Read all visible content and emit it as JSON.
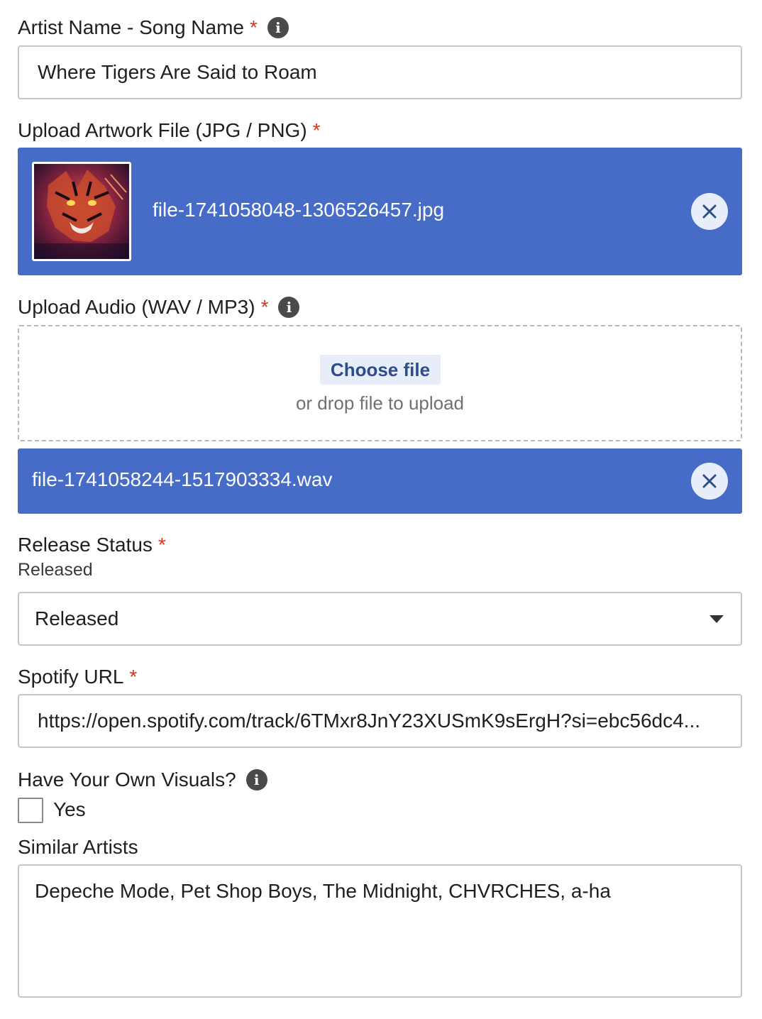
{
  "artist_song": {
    "label": "Artist Name - Song Name",
    "required_mark": "*",
    "value": "Where Tigers Are Said to Roam"
  },
  "artwork": {
    "label": "Upload Artwork File (JPG / PNG)",
    "required_mark": "*",
    "file_name": "file-1741058048-1306526457.jpg"
  },
  "audio": {
    "label": "Upload Audio (WAV / MP3)",
    "required_mark": "*",
    "choose_label": "Choose file",
    "drop_text": "or drop file to upload",
    "file_name": "file-1741058244-1517903334.wav"
  },
  "release_status": {
    "label": "Release Status",
    "required_mark": "*",
    "sub_value": "Released",
    "selected": "Released"
  },
  "spotify": {
    "label": "Spotify URL",
    "required_mark": "*",
    "value": "https://open.spotify.com/track/6TMxr8JnY23XUSmK9sErgH?si=ebc56dc4..."
  },
  "visuals": {
    "label": "Have Your Own Visuals?",
    "checkbox_label": "Yes",
    "checked": false
  },
  "similar_artists": {
    "label": "Similar Artists",
    "value": "Depeche Mode, Pet Shop Boys, The Midnight, CHVRCHES, a-ha"
  },
  "colors": {
    "accent": "#466cc8",
    "required": "#d9361e",
    "button_bg": "#e8eef9"
  },
  "icons": {
    "info": "info-icon",
    "remove": "close-icon",
    "dropdown": "caret-down-icon"
  }
}
